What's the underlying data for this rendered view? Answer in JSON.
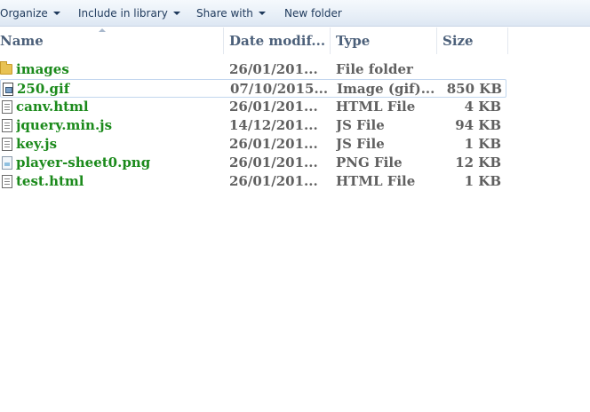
{
  "toolbar": {
    "organize": "Organize",
    "include_in_library": "Include in library",
    "share_with": "Share with",
    "new_folder": "New folder"
  },
  "columns": {
    "name": "Name",
    "date": "Date modif...",
    "type": "Type",
    "size": "Size"
  },
  "files": [
    {
      "icon": "folder-icon",
      "name": "images",
      "date": "26/01/201...",
      "type": "File folder",
      "size": ""
    },
    {
      "icon": "gif-image-icon",
      "name": "250.gif",
      "date": "07/10/2015...",
      "type": "Image (gif)...",
      "size": "850 KB"
    },
    {
      "icon": "html-file-icon",
      "name": "canv.html",
      "date": "26/01/201...",
      "type": "HTML File",
      "size": "4 KB"
    },
    {
      "icon": "js-file-icon",
      "name": "jquery.min.js",
      "date": "14/12/201...",
      "type": "JS File",
      "size": "94 KB"
    },
    {
      "icon": "js-file-icon",
      "name": "key.js",
      "date": "26/01/201...",
      "type": "JS File",
      "size": "1 KB"
    },
    {
      "icon": "png-image-icon",
      "name": "player-sheet0.png",
      "date": "26/01/201...",
      "type": "PNG File",
      "size": "12 KB"
    },
    {
      "icon": "html-file-icon",
      "name": "test.html",
      "date": "26/01/201...",
      "type": "HTML File",
      "size": "1 KB"
    }
  ],
  "colors": {
    "filename": "#1b8a1b",
    "detail_text": "#606060",
    "header_text": "#4c607a",
    "toolbar_text": "#1e395b"
  }
}
